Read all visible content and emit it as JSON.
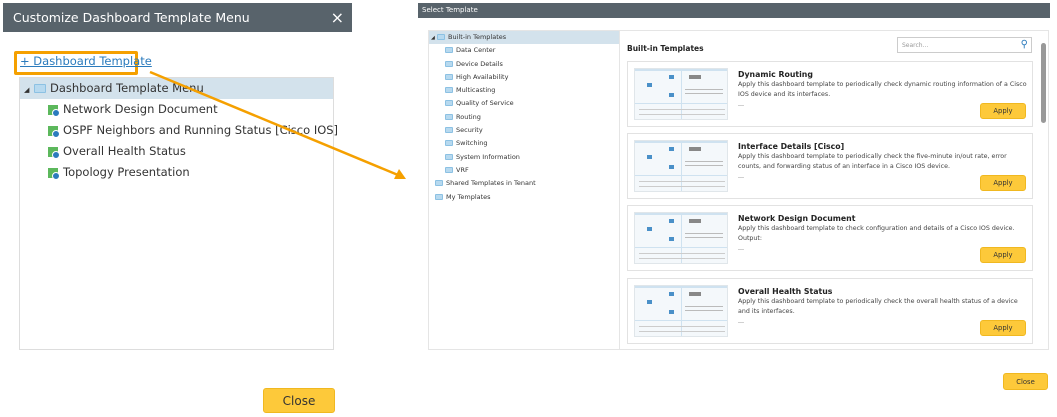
{
  "left_dialog": {
    "title": "Customize Dashboard Template Menu",
    "close_icon": "×",
    "add_link": "+ Dashboard Template",
    "tree_root": "Dashboard Template Menu",
    "items": [
      "Network Design Document",
      "OSPF Neighbors and Running Status [Cisco IOS]",
      "Overall Health Status",
      "Topology Presentation"
    ],
    "close_button": "Close"
  },
  "right_dialog": {
    "title": "Select Template",
    "tree": {
      "root": "Built-in Templates",
      "children": [
        "Data Center",
        "Device Details",
        "High Availability",
        "Multicasting",
        "Quality of Service",
        "Routing",
        "Security",
        "Switching",
        "System Information",
        "VRF"
      ],
      "others": [
        "Shared Templates in Tenant",
        "My Templates"
      ]
    },
    "heading": "Built-in Templates",
    "search_placeholder": "Search...",
    "cards": [
      {
        "title": "Dynamic Routing",
        "desc": "Apply this dashboard template to periodically check dynamic routing information of a Cisco IOS device and its interfaces.",
        "more": "...",
        "apply": "Apply"
      },
      {
        "title": "Interface Details [Cisco]",
        "desc": "Apply this dashboard template to periodically check the five-minute in/out rate, error counts, and forwarding status of an interface in a Cisco IOS device.",
        "more": "...",
        "apply": "Apply"
      },
      {
        "title": "Network Design Document",
        "desc": "Apply this dashboard template to check configuration and details of a Cisco IOS device.",
        "desc2": "Output:",
        "more": "...",
        "apply": "Apply"
      },
      {
        "title": "Overall Health Status",
        "desc": "Apply this dashboard template to periodically check the overall health status of a device and its interfaces.",
        "more": "...",
        "apply": "Apply"
      }
    ],
    "close_button": "Close"
  },
  "colors": {
    "titlebar": "#58636b",
    "accent": "#f5a000",
    "button": "#fdc93a",
    "link": "#2b7bbd",
    "selected": "#d3e2ec"
  }
}
